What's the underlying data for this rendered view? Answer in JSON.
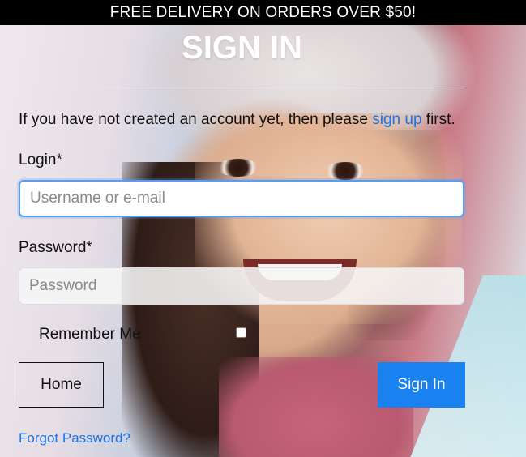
{
  "banner": {
    "text": "FREE DELIVERY ON ORDERS OVER $50!"
  },
  "page": {
    "title": "SIGN IN"
  },
  "intro": {
    "before": "If you have not created an account yet, then please ",
    "link": "sign up",
    "after": " first."
  },
  "form": {
    "login_label": "Login*",
    "login_placeholder": "Username or e-mail",
    "login_value": "",
    "password_label": "Password*",
    "password_placeholder": "Password",
    "password_value": "",
    "remember_label": "Remember Me",
    "remember_checked": false
  },
  "buttons": {
    "home": "Home",
    "sign_in": "Sign In"
  },
  "links": {
    "forgot": "Forgot Password?"
  },
  "colors": {
    "accent": "#1a82f0",
    "link": "#1a73e8",
    "banner_bg": "#000000"
  }
}
